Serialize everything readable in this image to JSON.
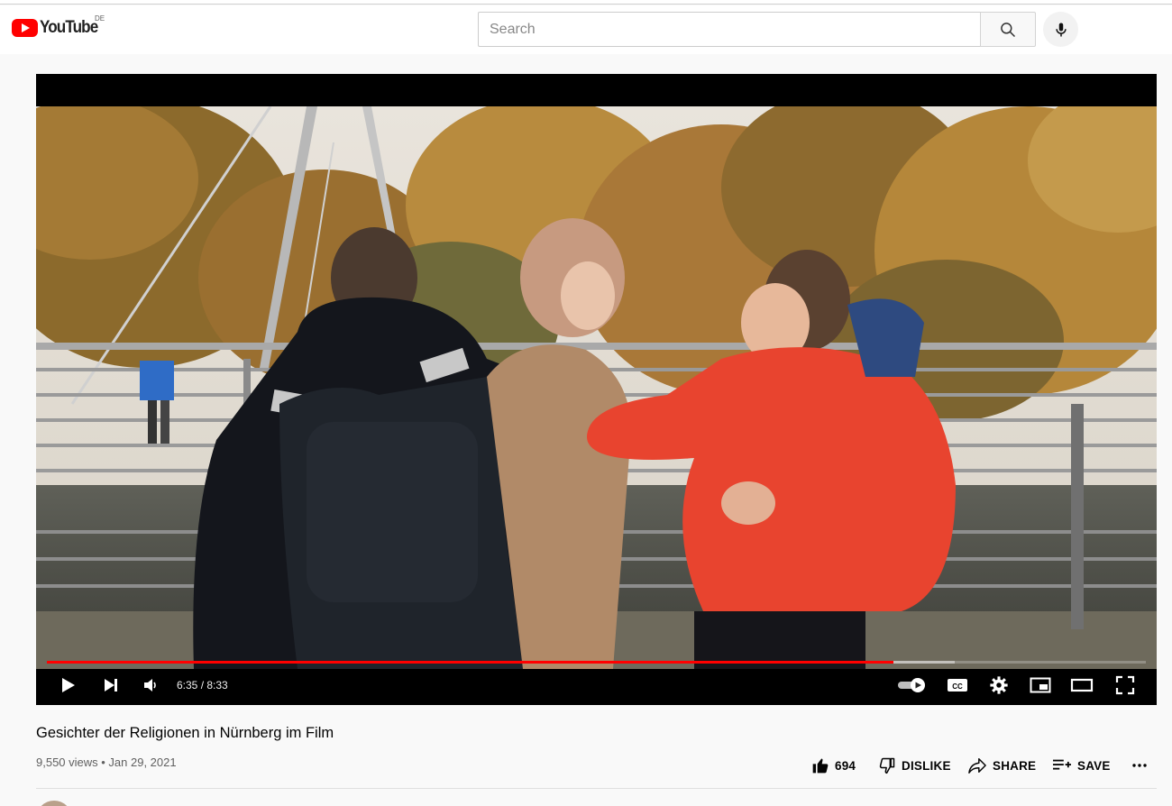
{
  "header": {
    "logo_text": "YouTube",
    "country_code": "DE",
    "search_placeholder": "Search"
  },
  "player": {
    "current_time": "6:35",
    "duration": "8:33",
    "time_display": "6:35 / 8:33",
    "progress_fraction": 0.7704,
    "loaded_fraction": 0.826,
    "accent_color": "#ff0000"
  },
  "video": {
    "title": "Gesichter der Religionen in Nürnberg im Film",
    "meta": "9,550 views • Jan 29, 2021"
  },
  "actions": {
    "like_count": "694",
    "dislike_label": "DISLIKE",
    "share_label": "SHARE",
    "save_label": "SAVE"
  }
}
